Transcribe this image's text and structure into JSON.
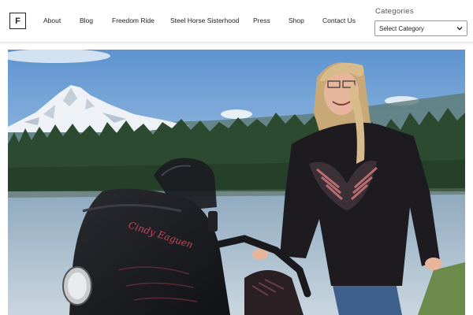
{
  "site": {
    "logo_letter": "F"
  },
  "nav": {
    "items": [
      {
        "label": "About"
      },
      {
        "label": "Blog"
      },
      {
        "label": "Freedom Ride"
      },
      {
        "label": "Steel Horse Sisterhood"
      },
      {
        "label": "Press"
      },
      {
        "label": "Shop"
      },
      {
        "label": "Contact Us"
      }
    ]
  },
  "categories_widget": {
    "title": "Categories",
    "selected": "Select Category"
  },
  "hero": {
    "fairing_script": "Cindy Eaguen",
    "colors": {
      "sky": "#6f9fd3",
      "mountain_snow": "#f2f5f8",
      "forest": "#2c4a2f",
      "lake": "#7f9db5",
      "bike": "#1c1d20",
      "shirt": "#1d1b20",
      "hair": "#d8bb8a"
    }
  }
}
